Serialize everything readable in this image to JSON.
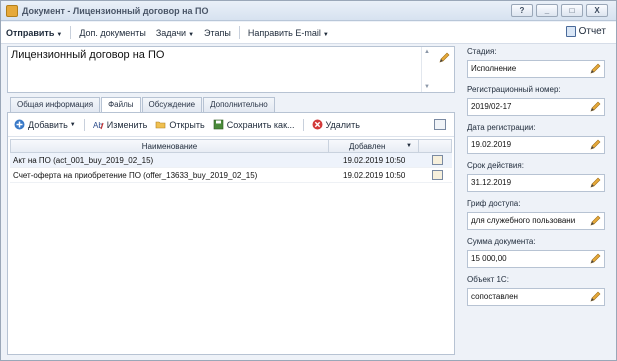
{
  "window": {
    "title": "Документ - Лицензионный договор на ПО",
    "controls": [
      "?",
      "_",
      "□",
      "X"
    ]
  },
  "menu": {
    "send": "Отправить",
    "extra_docs": "Доп. документы",
    "tasks": "Задачи",
    "stages": "Этапы",
    "email": "Направить E-mail",
    "report": "Отчет"
  },
  "document": {
    "description": "Лицензионный договор на ПО"
  },
  "tabs": [
    {
      "label": "Общая информация",
      "active": false
    },
    {
      "label": "Файлы",
      "active": true
    },
    {
      "label": "Обсуждение",
      "active": false
    },
    {
      "label": "Дополнительно",
      "active": false
    }
  ],
  "toolbar": {
    "add": "Добавить",
    "edit": "Изменить",
    "open": "Открыть",
    "save_as": "Сохранить как...",
    "delete": "Удалить"
  },
  "files": {
    "columns": {
      "name": "Наименование",
      "added": "Добавлен"
    },
    "rows": [
      {
        "name": "Акт на ПО (act_001_buy_2019_02_15)",
        "added": "19.02.2019 10:50"
      },
      {
        "name": "Счет-оферта на приобретение ПО  (offer_13633_buy_2019_02_15)",
        "added": "19.02.2019 10:50"
      }
    ]
  },
  "fields": [
    {
      "label": "Стадия:",
      "value": "Исполнение"
    },
    {
      "label": "Регистрационный номер:",
      "value": "2019/02-17"
    },
    {
      "label": "Дата регистрации:",
      "value": "19.02.2019"
    },
    {
      "label": "Срок действия:",
      "value": "31.12.2019"
    },
    {
      "label": "Гриф доступа:",
      "value": "для служебного пользовани"
    },
    {
      "label": "Сумма документа:",
      "value": "15 000,00"
    },
    {
      "label": "Объект 1С:",
      "value": "сопоставлен"
    }
  ],
  "colors": {
    "accent": "#e6a93a",
    "border": "#b7c3d3",
    "background": "#eef2f8"
  }
}
